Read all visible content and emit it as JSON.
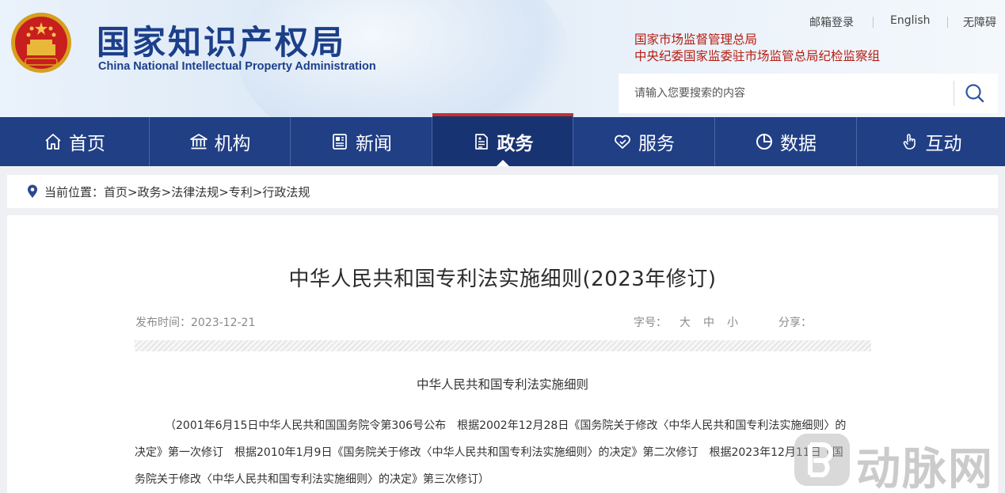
{
  "header": {
    "title_cn": "国家知识产权局",
    "title_en": "China National Intellectual Property Administration",
    "top_links": [
      "邮箱登录",
      "English",
      "无障碍"
    ],
    "org_lines": [
      "国家市场监督管理总局",
      "中央纪委国家监委驻市场监管总局纪检监察组"
    ],
    "search": {
      "placeholder": "请输入您要搜索的内容",
      "icon": "search-icon"
    },
    "colors": {
      "title": "#1c3f8a",
      "org": "#b51c12"
    }
  },
  "nav": {
    "items": [
      {
        "label": "首页",
        "icon": "home-icon"
      },
      {
        "label": "机构",
        "icon": "institution-icon"
      },
      {
        "label": "新闻",
        "icon": "news-icon"
      },
      {
        "label": "政务",
        "icon": "government-affairs-icon",
        "active": true
      },
      {
        "label": "服务",
        "icon": "service-icon"
      },
      {
        "label": "数据",
        "icon": "data-icon"
      },
      {
        "label": "互动",
        "icon": "interaction-icon"
      }
    ],
    "colors": {
      "bg": "#203f85",
      "active_bg": "#183372",
      "active_border": "#c8302a"
    }
  },
  "breadcrumb": {
    "label": "当前位置：",
    "items": [
      "首页",
      "政务",
      "法律法规",
      "专利",
      "行政法规"
    ],
    "separator": ">"
  },
  "article": {
    "title": "中华人民共和国专利法实施细则(2023年修订)",
    "date_label": "发布时间：",
    "date": "2023-12-21",
    "font_size_label": "字号：",
    "font_sizes": [
      "大",
      "中",
      "小"
    ],
    "share_label": "分享：",
    "subtitle": "中华人民共和国专利法实施细则",
    "paragraph_lines": [
      "（2001年6月15日中华人民共和国国务院令第306号公布　根据2002年12月28日《国务院关于修改〈中华人民共和国专利法实施细则〉的",
      "决定》第一次修订　根据2010年1月9日《国务院关于修改〈中华人民共和国专利法实施细则〉的决定》第二次修订　根据2023年12月11日《国",
      "务院关于修改〈中华人民共和国专利法实施细则〉的决定》第三次修订）"
    ]
  },
  "watermark": {
    "text": "动脉网"
  }
}
